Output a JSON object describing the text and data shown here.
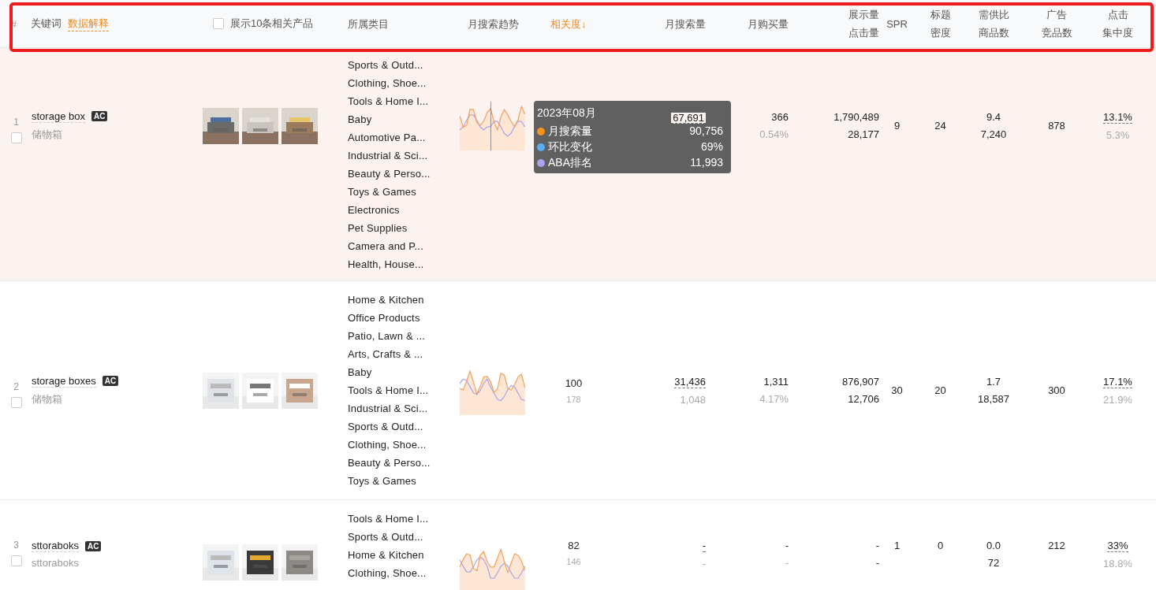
{
  "header": {
    "columns": [
      {
        "kind": "index",
        "lines": [
          "#"
        ]
      },
      {
        "kind": "keyword",
        "lines": [
          "关键词"
        ],
        "link": "数据解释"
      },
      {
        "kind": "products",
        "lines": [
          "展示10条相关产品"
        ],
        "checked": false
      },
      {
        "kind": "text",
        "lines": [
          "所属类目"
        ]
      },
      {
        "kind": "text",
        "lines": [
          "月搜索趋势"
        ]
      },
      {
        "kind": "sort",
        "lines": [
          "相关度↓"
        ],
        "selected": true
      },
      {
        "kind": "text",
        "lines": [
          "月搜索量"
        ]
      },
      {
        "kind": "text",
        "lines": [
          "月购买量"
        ]
      },
      {
        "kind": "text",
        "lines": [
          "展示量",
          "点击量"
        ]
      },
      {
        "kind": "text",
        "lines": [
          "SPR"
        ]
      },
      {
        "kind": "text",
        "lines": [
          "标题",
          "密度"
        ]
      },
      {
        "kind": "text",
        "lines": [
          "需供比",
          "商品数"
        ]
      },
      {
        "kind": "text",
        "lines": [
          "广告",
          "竞品数"
        ]
      },
      {
        "kind": "text",
        "lines": [
          "点击",
          "集中度"
        ]
      }
    ]
  },
  "rows": [
    {
      "index": "1",
      "keyword": "storage box",
      "badge": "AC",
      "translation": "储物箱",
      "checked": false,
      "highlighted": true,
      "categories": [
        "Sports & Outd...",
        "Clothing, Shoe...",
        "Tools & Home I...",
        "Baby",
        "Automotive Pa...",
        "Industrial & Sci...",
        "Beauty & Perso...",
        "Toys & Games",
        "Electronics",
        "Pet Supplies",
        "Camera and P...",
        "Health, House..."
      ],
      "search": "67,691",
      "purchase": "366",
      "purchase_rate": "0.54%",
      "impressions": "1,790,489",
      "clicks": "28,177",
      "spr": "9",
      "title_density": "24",
      "ratio": "9.4",
      "products_count": "7,240",
      "ads": "878",
      "click_share": "13.1%",
      "click_share_sub": "5.3%",
      "tooltip": {
        "title": "2023年08月",
        "items": [
          {
            "label": "月搜索量",
            "value": "90,756",
            "color": "#f7931e"
          },
          {
            "label": "环比变化",
            "value": "69%",
            "color": "#5aaef5"
          },
          {
            "label": "ABA排名",
            "value": "11,993",
            "color": "#a9a3f0"
          }
        ]
      }
    },
    {
      "index": "2",
      "keyword": "storage boxes",
      "badge": "AC",
      "translation": "储物箱",
      "checked": false,
      "highlighted": false,
      "categories": [
        "Home & Kitchen",
        "Office Products",
        "Patio, Lawn & ...",
        "Arts, Crafts & ...",
        "Baby",
        "Tools & Home I...",
        "Industrial & Sci...",
        "Sports & Outd...",
        "Clothing, Shoe...",
        "Beauty & Perso...",
        "Toys & Games"
      ],
      "relevance": "100",
      "relevance_sub": "178",
      "search": "31,436",
      "search_sub": "1,048",
      "purchase": "1,311",
      "purchase_rate": "4.17%",
      "impressions": "876,907",
      "clicks": "12,706",
      "spr": "30",
      "title_density": "20",
      "ratio": "1.7",
      "products_count": "18,587",
      "ads": "300",
      "click_share": "17.1%",
      "click_share_sub": "21.9%"
    },
    {
      "index": "3",
      "keyword": "sttoraboks",
      "badge": "AC",
      "translation": "sttoraboks",
      "checked": false,
      "highlighted": false,
      "categories": [
        "Tools & Home I...",
        "Sports & Outd...",
        "Home & Kitchen",
        "Clothing, Shoe..."
      ],
      "relevance": "82",
      "relevance_sub": "146",
      "search": "-",
      "search_sub": "-",
      "purchase": "-",
      "purchase_rate": "-",
      "impressions": "-",
      "clicks": "-",
      "spr": "1",
      "title_density": "0",
      "ratio": "0.0",
      "products_count": "72",
      "ads": "212",
      "click_share": "33%",
      "click_share_sub": "18.8%"
    }
  ]
}
